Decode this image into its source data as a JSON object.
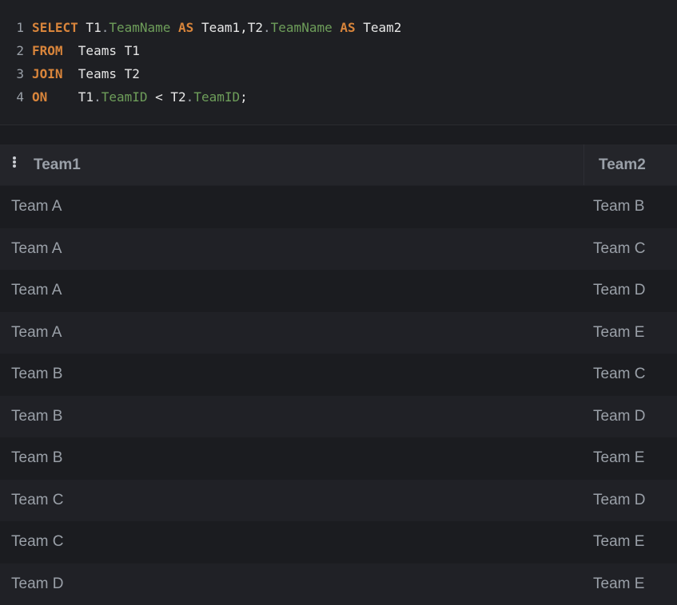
{
  "editor": {
    "lines": [
      {
        "number": "1",
        "tokens": [
          {
            "t": "kw",
            "v": "SELECT"
          },
          {
            "t": "id",
            "v": " T1"
          },
          {
            "t": "punct",
            "v": "."
          },
          {
            "t": "fld",
            "v": "TeamName"
          },
          {
            "t": "id",
            "v": " "
          },
          {
            "t": "kw",
            "v": "AS"
          },
          {
            "t": "id",
            "v": " Team1,T2"
          },
          {
            "t": "punct",
            "v": "."
          },
          {
            "t": "fld",
            "v": "TeamName"
          },
          {
            "t": "id",
            "v": " "
          },
          {
            "t": "kw",
            "v": "AS"
          },
          {
            "t": "id",
            "v": " Team2"
          }
        ]
      },
      {
        "number": "2",
        "tokens": [
          {
            "t": "kw",
            "v": "FROM"
          },
          {
            "t": "id",
            "v": "  Teams T1"
          }
        ]
      },
      {
        "number": "3",
        "tokens": [
          {
            "t": "kw",
            "v": "JOIN"
          },
          {
            "t": "id",
            "v": "  Teams T2"
          }
        ]
      },
      {
        "number": "4",
        "tokens": [
          {
            "t": "kw",
            "v": "ON"
          },
          {
            "t": "id",
            "v": "    T1"
          },
          {
            "t": "punct",
            "v": "."
          },
          {
            "t": "fld",
            "v": "TeamID"
          },
          {
            "t": "id",
            "v": " < T2"
          },
          {
            "t": "punct",
            "v": "."
          },
          {
            "t": "fld",
            "v": "TeamID"
          },
          {
            "t": "id",
            "v": ";"
          }
        ]
      }
    ]
  },
  "results": {
    "menu_icon": "vertical-dots-icon",
    "columns": [
      "Team1",
      "Team2"
    ],
    "rows": [
      [
        "Team A",
        "Team B"
      ],
      [
        "Team A",
        "Team C"
      ],
      [
        "Team A",
        "Team D"
      ],
      [
        "Team A",
        "Team E"
      ],
      [
        "Team B",
        "Team C"
      ],
      [
        "Team B",
        "Team D"
      ],
      [
        "Team B",
        "Team E"
      ],
      [
        "Team C",
        "Team D"
      ],
      [
        "Team C",
        "Team E"
      ],
      [
        "Team D",
        "Team E"
      ]
    ]
  }
}
